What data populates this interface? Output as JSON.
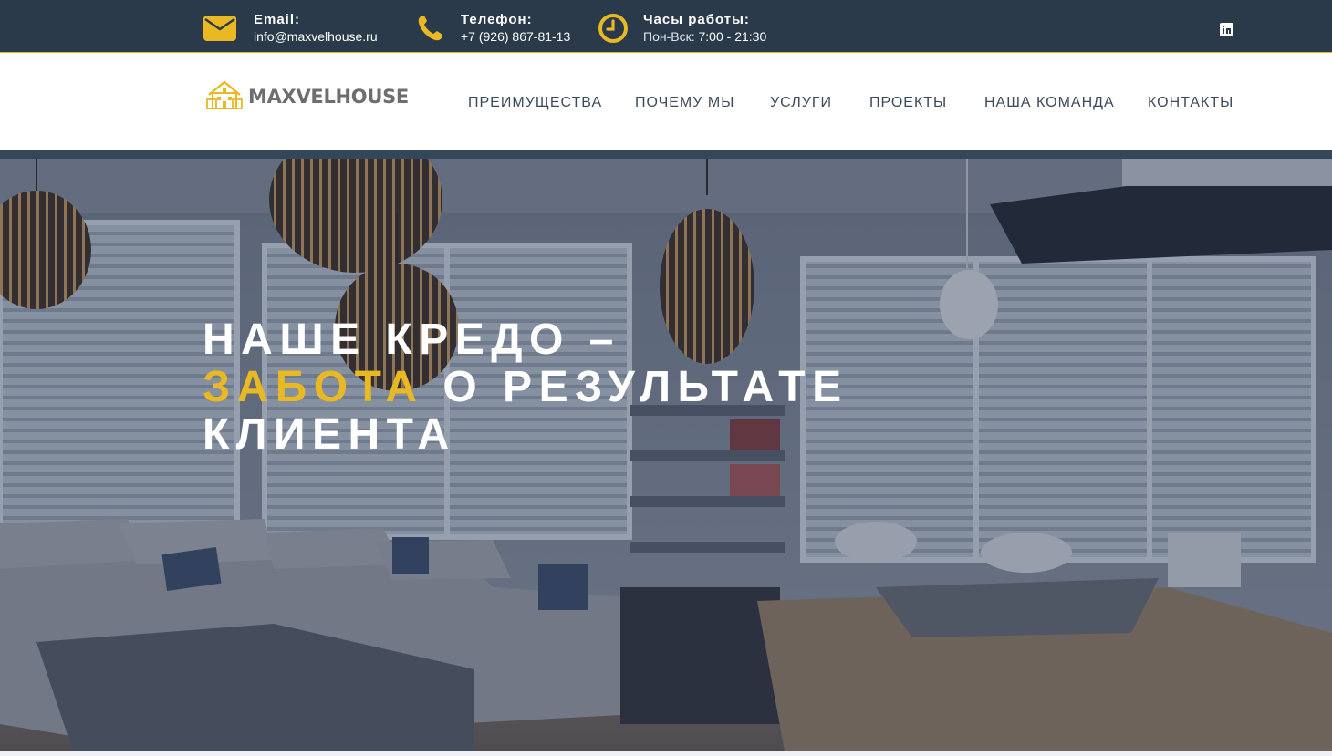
{
  "colors": {
    "topbar_bg": "#2b3a4b",
    "accent": "#e8b923",
    "nav_text": "#3b4a5c",
    "logo_text": "#6d6e71"
  },
  "topbar": {
    "email": {
      "icon": "envelope-icon",
      "label": "Email:",
      "value": "info@maxvelhouse.ru"
    },
    "phone": {
      "icon": "phone-icon",
      "label": "Телефон:",
      "value": "+7 (926) 867-81-13"
    },
    "hours": {
      "icon": "clock-icon",
      "label": "Часы работы:",
      "days": "Пон-Вск:",
      "time": "7:00 - 21:30"
    },
    "social": {
      "icon": "linkedin-icon"
    }
  },
  "header": {
    "logo": {
      "icon": "house-logo-icon",
      "text": "MAXVELHOUSE"
    },
    "nav": [
      {
        "label": "ПРЕИМУЩЕСТВА"
      },
      {
        "label": "ПОЧЕМУ МЫ"
      },
      {
        "label": "УСЛУГИ"
      },
      {
        "label": "ПРОЕКТЫ"
      },
      {
        "label": "НАША КОМАНДА"
      },
      {
        "label": "КОНТАКТЫ"
      }
    ]
  },
  "hero": {
    "line1": "НАШЕ КРЕДО –",
    "line2_accent": "ЗАБОТА",
    "line2_rest": "О РЕЗУЛЬТАТЕ",
    "line3": "КЛИЕНТА"
  }
}
